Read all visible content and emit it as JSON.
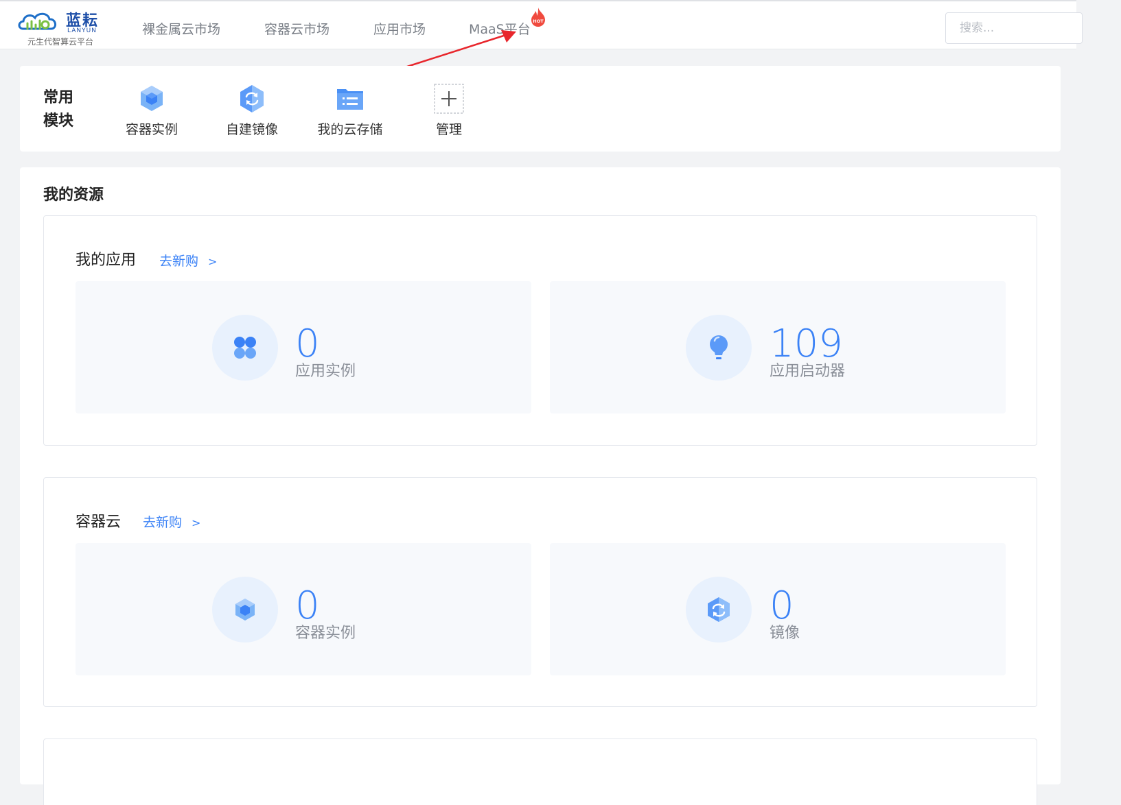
{
  "header": {
    "logo": {
      "name_cn": "蓝耘",
      "name_en": "LANYUN",
      "tagline": "元生代智算云平台"
    },
    "nav": [
      {
        "label": "裸金属云市场"
      },
      {
        "label": "容器云市场"
      },
      {
        "label": "应用市场"
      },
      {
        "label": "MaaS平台"
      }
    ],
    "hot_badge": "HOT",
    "search": {
      "placeholder": "搜索...",
      "value": ""
    }
  },
  "common_modules": {
    "title": "常用模块",
    "items": [
      {
        "label": "容器实例",
        "icon": "container-cube-icon"
      },
      {
        "label": "自建镜像",
        "icon": "image-sync-icon"
      },
      {
        "label": "我的云存储",
        "icon": "folder-list-icon"
      },
      {
        "label": "管理",
        "icon": "plus-icon"
      }
    ]
  },
  "resources": {
    "title": "我的资源",
    "sections": [
      {
        "title": "我的应用",
        "link": "去新购",
        "link_chevron": ">",
        "stats": [
          {
            "value": "0",
            "label": "应用实例",
            "icon": "clover-icon"
          },
          {
            "value": "109",
            "label": "应用启动器",
            "icon": "lightbulb-icon"
          }
        ]
      },
      {
        "title": "容器云",
        "link": "去新购",
        "link_chevron": ">",
        "stats": [
          {
            "value": "0",
            "label": "容器实例",
            "icon": "container-cube-icon"
          },
          {
            "value": "0",
            "label": "镜像",
            "icon": "image-sync-icon"
          }
        ]
      }
    ]
  },
  "colors": {
    "accent": "#3b82f6",
    "annotation_arrow": "#e8262c",
    "stat_bg": "#f7f9fc",
    "icon_circle_bg": "#e8f1fd"
  }
}
